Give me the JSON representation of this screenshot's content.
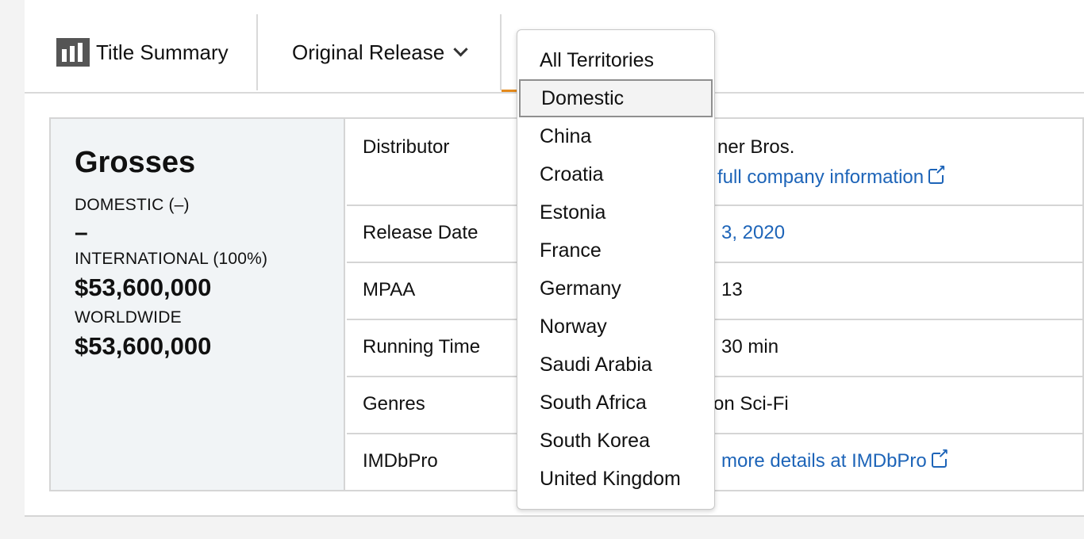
{
  "tabs": {
    "title_summary": "Title Summary",
    "original_release": "Original Release"
  },
  "grosses": {
    "heading": "Grosses",
    "domestic_label": "DOMESTIC (–)",
    "domestic_value": "–",
    "international_label": "INTERNATIONAL (100%)",
    "international_value": "$53,600,000",
    "worldwide_label": "WORLDWIDE",
    "worldwide_value": "$53,600,000"
  },
  "details": {
    "distributor_label": "Distributor",
    "distributor_value": "ner Bros.",
    "distributor_link": "full company information",
    "release_date_label": "Release Date",
    "release_date_value": "3, 2020",
    "mpaa_label": "MPAA",
    "mpaa_value": "13",
    "running_time_label": "Running Time",
    "running_time_value": "30 min",
    "genres_label": "Genres",
    "genres_value": "on Sci-Fi",
    "imdbpro_label": "IMDbPro",
    "imdbpro_link": "more details at IMDbPro"
  },
  "territory_dropdown": {
    "selected": "Domestic",
    "options": [
      "All Territories",
      "Domestic",
      "China",
      "Croatia",
      "Estonia",
      "France",
      "Germany",
      "Norway",
      "Saudi Arabia",
      "South Africa",
      "South Korea",
      "United Kingdom"
    ]
  },
  "colors": {
    "link": "#1d64b8",
    "accent_underline": "#e48a1d",
    "grosses_bg": "#f1f4f6"
  }
}
